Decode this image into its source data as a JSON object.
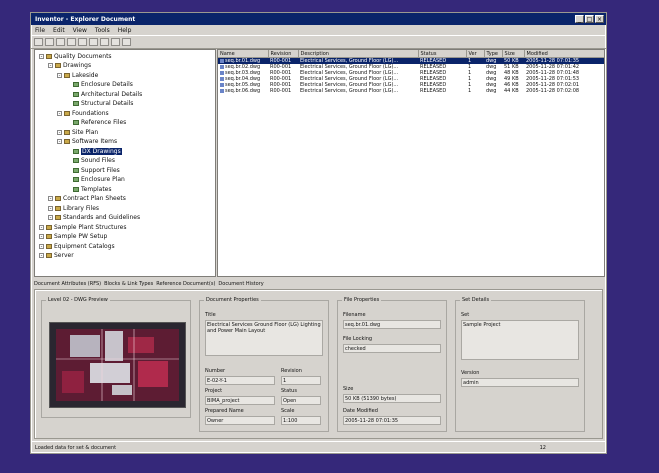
{
  "window": {
    "title": "Inventor - Explorer Document"
  },
  "menu": [
    "File",
    "Edit",
    "View",
    "Tools",
    "Help"
  ],
  "tree": {
    "items": [
      {
        "label": "Quality Documents",
        "level": 0,
        "icon": "folder-icon"
      },
      {
        "label": "Drawings",
        "level": 1,
        "icon": "folder-icon"
      },
      {
        "label": "Lakeside",
        "level": 2,
        "icon": "folder-icon"
      },
      {
        "label": "Enclosure Details",
        "level": 3,
        "icon": "document-icon"
      },
      {
        "label": "Architectural Details",
        "level": 3,
        "icon": "document-icon"
      },
      {
        "label": "Structural Details",
        "level": 3,
        "icon": "document-icon"
      },
      {
        "label": "Foundations",
        "level": 2,
        "icon": "folder-icon"
      },
      {
        "label": "Reference Files",
        "level": 3,
        "icon": "document-icon"
      },
      {
        "label": "Site Plan",
        "level": 2,
        "icon": "folder-icon"
      },
      {
        "label": "Software Items",
        "level": 2,
        "icon": "folder-icon"
      },
      {
        "label": "DX Drawings",
        "level": 3,
        "icon": "document-icon",
        "selected": true
      },
      {
        "label": "Sound Files",
        "level": 3,
        "icon": "document-icon"
      },
      {
        "label": "Support Files",
        "level": 3,
        "icon": "document-icon"
      },
      {
        "label": "Enclosure Plan",
        "level": 3,
        "icon": "document-icon"
      },
      {
        "label": "Templates",
        "level": 3,
        "icon": "document-icon"
      },
      {
        "label": "Contract Plan Sheets",
        "level": 1,
        "icon": "folder-icon"
      },
      {
        "label": "Library Files",
        "level": 1,
        "icon": "folder-icon"
      },
      {
        "label": "Standards and Guidelines",
        "level": 1,
        "icon": "folder-icon"
      },
      {
        "label": "Sample Plant Structures",
        "level": 0,
        "icon": "folder-icon"
      },
      {
        "label": "Sample PW Setup",
        "level": 0,
        "icon": "folder-icon"
      },
      {
        "label": "Equipment Catalogs",
        "level": 0,
        "icon": "folder-icon"
      },
      {
        "label": "Server",
        "level": 0,
        "icon": "folder-icon"
      }
    ]
  },
  "list": {
    "columns": [
      "Name",
      "Revision",
      "Description",
      "Status",
      "Ver",
      "Type",
      "Size",
      "Modified"
    ],
    "rows": [
      [
        "seq.br.01.dwg",
        "R00-001",
        "Electrical Services, Ground Floor (LG)...",
        "RELEASED",
        "1",
        "dwg",
        "50 KB",
        "2005-11-28 07:01:35"
      ],
      [
        "seq.br.02.dwg",
        "R00-001",
        "Electrical Services, Ground Floor (LG)...",
        "RELEASED",
        "1",
        "dwg",
        "51 KB",
        "2005-11-28 07:01:42"
      ],
      [
        "seq.br.03.dwg",
        "R00-001",
        "Electrical Services, Ground Floor (LG)...",
        "RELEASED",
        "1",
        "dwg",
        "48 KB",
        "2005-11-28 07:01:48"
      ],
      [
        "seq.br.04.dwg",
        "R00-001",
        "Electrical Services, Ground Floor (LG)...",
        "RELEASED",
        "1",
        "dwg",
        "49 KB",
        "2005-11-28 07:01:53"
      ],
      [
        "seq.br.05.dwg",
        "R00-001",
        "Electrical Services, Ground Floor (LG)...",
        "RELEASED",
        "1",
        "dwg",
        "46 KB",
        "2005-11-28 07:02:01"
      ],
      [
        "seq.br.06.dwg",
        "R00-001",
        "Electrical Services, Ground Floor (LG)...",
        "RELEASED",
        "1",
        "dwg",
        "44 KB",
        "2005-11-28 07:02:08"
      ]
    ]
  },
  "tabs": [
    "Document Attributes (RFS)",
    "Blocks & Link Types",
    "Reference Document(s)",
    "Document History"
  ],
  "detail": {
    "preview_title": "Level 02 - DWG Preview",
    "doc_props_title": "Document Properties",
    "title_label": "Title",
    "title_value": "Electrical Services Ground Floor (LG) Lighting and Power Main Layout",
    "number_label": "Number",
    "number_value": "E-02-Y-1",
    "revision_label": "Revision",
    "revision_value": "1",
    "project_label": "Project",
    "project_value": "BIMA_project",
    "status_label": "Status",
    "status_value": "Open",
    "prepared_label": "Prepared Name",
    "prepared_value": "Owner",
    "scale_label": "Scale",
    "scale_value": "1:100",
    "file_props_title": "File Properties",
    "filename_label": "Filename",
    "filename_value": "seq.br.01.dwg",
    "filesize_label": "File Locking",
    "filesize_value": "checked",
    "size_label": "Size",
    "size_value": "50 KB (51390 bytes)",
    "modified_label": "Date Modified",
    "modified_value": "2005-11-28 07:01:35",
    "set_details_title": "Set Details",
    "set_name_label": "Set",
    "set_name_value": "Sample Project",
    "set_owner_label": "Version",
    "set_owner_value": "admin"
  },
  "status": {
    "text": "Loaded data for set & document",
    "right": "12"
  }
}
